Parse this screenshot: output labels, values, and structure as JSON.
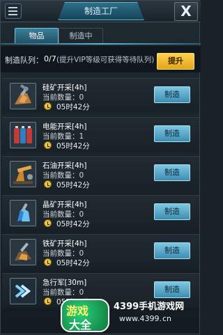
{
  "header": {
    "title": "制造工厂",
    "close_label": "X"
  },
  "tabs": [
    {
      "label": "物品",
      "active": true
    },
    {
      "label": "制造中",
      "active": false
    }
  ],
  "queue": {
    "label": "制造队列：",
    "count": "0/7",
    "hint": "(提升VIP等级可获得等待队列)",
    "boost_label": "提升"
  },
  "items": [
    {
      "name": "硅矿开采[4h]",
      "count": "当前数量：0",
      "time": "05时42分",
      "button": "制造",
      "icon": "silicon-mining-icon"
    },
    {
      "name": "电能开采[4h]",
      "count": "当前数量：1",
      "time": "05时42分",
      "button": "制造",
      "icon": "battery-icon"
    },
    {
      "name": "石油开采[4h]",
      "count": "当前数量：0",
      "time": "05时42分",
      "button": "制造",
      "icon": "oil-pump-icon"
    },
    {
      "name": "晶矿开采[4h]",
      "count": "当前数量：0",
      "time": "05时42分",
      "button": "制造",
      "icon": "crystal-icon"
    },
    {
      "name": "铁矿开采[4h]",
      "count": "当前数量：0",
      "time": "05时42分",
      "button": "制造",
      "icon": "iron-ore-icon"
    },
    {
      "name": "急行军[30m]",
      "count": "当前数量：0",
      "time": "05时42分",
      "button": "制造",
      "icon": "march-chevron-icon"
    }
  ],
  "watermark": {
    "badge_top": "游戏",
    "badge_bottom": "大全",
    "site": "4399手机游戏网",
    "url_part1": "www.4399.",
    "url_part2": "cn"
  }
}
